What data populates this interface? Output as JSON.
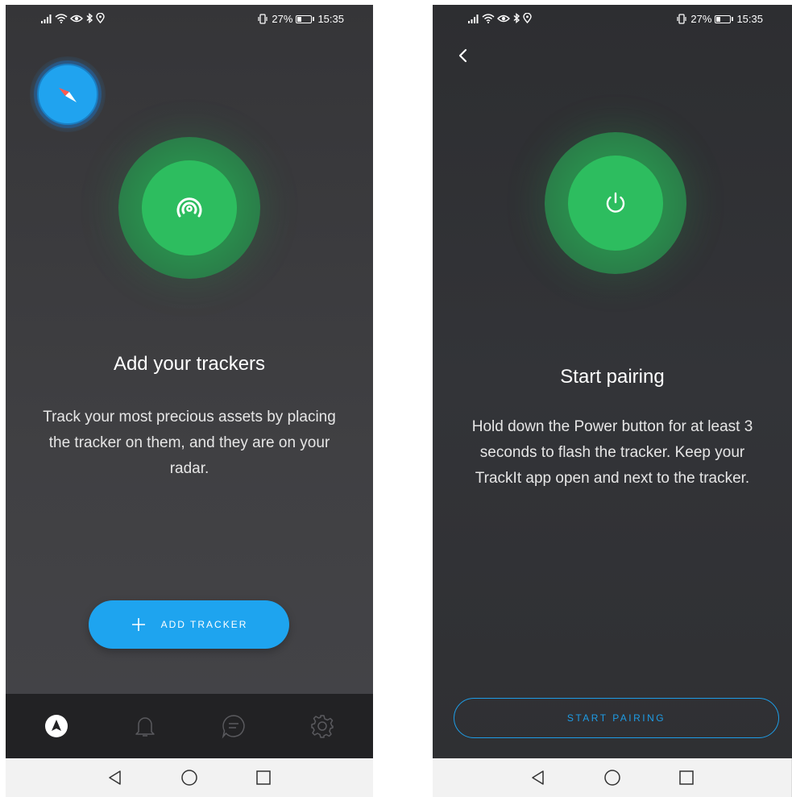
{
  "status_bar": {
    "battery_text": "27%",
    "time": "15:35"
  },
  "screen1": {
    "title": "Add your trackers",
    "description": "Track your most precious assets by placing the tracker on them, and they are on your radar.",
    "add_button_label": "ADD TRACKER",
    "tabs": [
      {
        "icon": "navigation-icon",
        "active": true
      },
      {
        "icon": "bell-icon",
        "active": false
      },
      {
        "icon": "chat-icon",
        "active": false
      },
      {
        "icon": "gear-icon",
        "active": false
      }
    ]
  },
  "screen2": {
    "title": "Start pairing",
    "description": "Hold down the Power button for at least 3 seconds to flash the tracker. Keep your TrackIt app open and next to the tracker.",
    "pair_button_label": "START PAIRING"
  },
  "colors": {
    "accent_blue": "#1ea4ef",
    "green": "#2dbd5f",
    "dark_bg": "#3a3a3d"
  }
}
